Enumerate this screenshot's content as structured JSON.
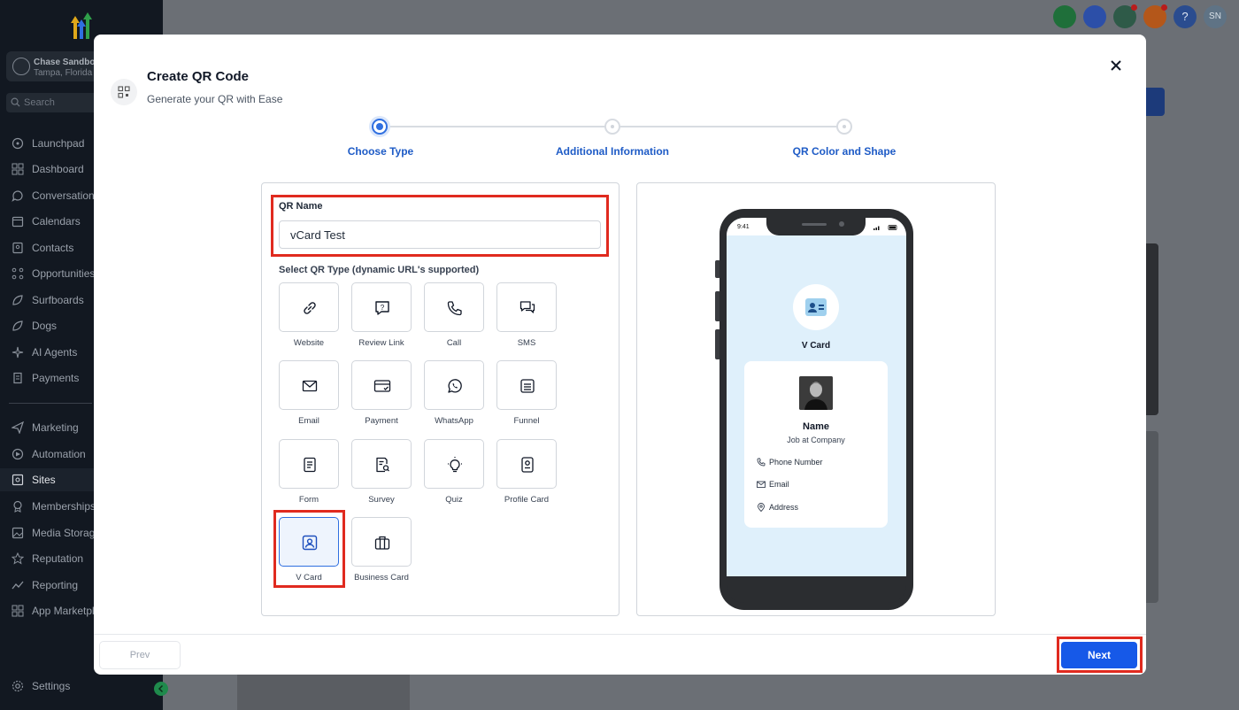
{
  "sidebar": {
    "account_name": "Chase Sandbox",
    "account_location": "Tampa, Florida",
    "search_placeholder": "Search",
    "items": [
      {
        "label": "Launchpad",
        "icon": "rocket-icon"
      },
      {
        "label": "Dashboard",
        "icon": "grid-icon"
      },
      {
        "label": "Conversations",
        "icon": "chat-icon"
      },
      {
        "label": "Calendars",
        "icon": "calendar-icon"
      },
      {
        "label": "Contacts",
        "icon": "contacts-icon"
      },
      {
        "label": "Opportunities",
        "icon": "opportunities-icon"
      },
      {
        "label": "Surfboards",
        "icon": "surfboard-icon"
      },
      {
        "label": "Dogs",
        "icon": "dog-icon"
      },
      {
        "label": "AI Agents",
        "icon": "sparkle-icon"
      },
      {
        "label": "Payments",
        "icon": "receipt-icon"
      },
      {
        "label": "Marketing",
        "icon": "send-icon"
      },
      {
        "label": "Automation",
        "icon": "automation-icon"
      },
      {
        "label": "Sites",
        "icon": "sites-icon"
      },
      {
        "label": "Memberships",
        "icon": "award-icon"
      },
      {
        "label": "Media Storage",
        "icon": "image-icon"
      },
      {
        "label": "Reputation",
        "icon": "star-icon"
      },
      {
        "label": "Reporting",
        "icon": "trend-icon"
      },
      {
        "label": "App Marketplace",
        "icon": "apps-icon"
      }
    ],
    "settings_label": "Settings",
    "active_item": "Sites"
  },
  "topbar": {
    "user_initials": "SN",
    "help_glyph": "?"
  },
  "modal": {
    "title": "Create QR Code",
    "subtitle": "Generate your QR with Ease",
    "steps": [
      {
        "label": "Choose Type",
        "state": "active"
      },
      {
        "label": "Additional Information",
        "state": "todo"
      },
      {
        "label": "QR Color and Shape",
        "state": "todo"
      }
    ],
    "qr_name_label": "QR Name",
    "qr_name_value": "vCard Test",
    "type_label": "Select QR Type (dynamic URL's supported)",
    "types": [
      {
        "label": "Website",
        "icon": "link-icon"
      },
      {
        "label": "Review Link",
        "icon": "review-icon"
      },
      {
        "label": "Call",
        "icon": "phone-icon"
      },
      {
        "label": "SMS",
        "icon": "sms-icon"
      },
      {
        "label": "Email",
        "icon": "email-icon"
      },
      {
        "label": "Payment",
        "icon": "payment-icon"
      },
      {
        "label": "WhatsApp",
        "icon": "whatsapp-icon"
      },
      {
        "label": "Funnel",
        "icon": "funnel-icon"
      },
      {
        "label": "Form",
        "icon": "form-icon"
      },
      {
        "label": "Survey",
        "icon": "survey-icon"
      },
      {
        "label": "Quiz",
        "icon": "bulb-icon"
      },
      {
        "label": "Profile Card",
        "icon": "profile-card-icon"
      },
      {
        "label": "V Card",
        "icon": "vcard-icon"
      },
      {
        "label": "Business Card",
        "icon": "briefcase-icon"
      }
    ],
    "selected_type": "V Card",
    "preview": {
      "time": "9:41",
      "header": "V Card",
      "name": "Name",
      "job": "Job at Company",
      "phone": "Phone Number",
      "email": "Email",
      "address": "Address"
    },
    "prev_label": "Prev",
    "next_label": "Next"
  },
  "colors": {
    "primary": "#1659e8",
    "step_active": "#2f6fe0",
    "highlight_red": "#e02a1f",
    "sidebar_bg": "#121821"
  }
}
